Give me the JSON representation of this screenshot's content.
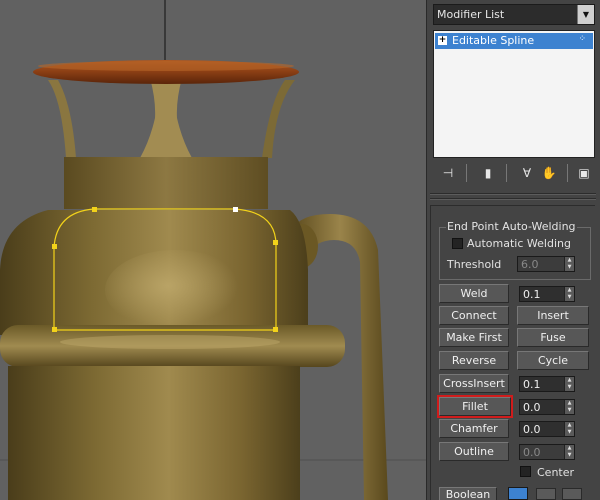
{
  "panel": {
    "modifier_list": "Modifier List",
    "stack_items": [
      {
        "label": "Editable Spline",
        "expander": "+"
      }
    ],
    "stack_tools": [
      "pin-stack-icon",
      "show-end-result-icon",
      "make-unique-icon",
      "remove-modifier-icon",
      "configure-sets-icon"
    ],
    "end_point_welding": {
      "title": "End Point Auto-Welding",
      "automatic_welding_label": "Automatic Welding",
      "automatic_welding_checked": false,
      "threshold_label": "Threshold",
      "threshold_value": "6.0"
    },
    "weld": {
      "label": "Weld",
      "value": "0.1"
    },
    "connect_label": "Connect",
    "insert_label": "Insert",
    "make_first_label": "Make First",
    "fuse_label": "Fuse",
    "reverse_label": "Reverse",
    "cycle_label": "Cycle",
    "crossinsert": {
      "label": "CrossInsert",
      "value": "0.1"
    },
    "fillet": {
      "label": "Fillet",
      "value": "0.0",
      "highlighted": true
    },
    "chamfer": {
      "label": "Chamfer",
      "value": "0.0"
    },
    "outline": {
      "label": "Outline",
      "value": "0.0"
    },
    "center_label": "Center",
    "center_checked": false,
    "boolean_label": "Boolean",
    "highlight_color": "#d01c1c",
    "selection_color": "#3d82d0"
  },
  "viewport": {
    "object_color": "#7d6a32",
    "lid_color": "#8a3e14",
    "spline_color": "#f2d21a"
  }
}
